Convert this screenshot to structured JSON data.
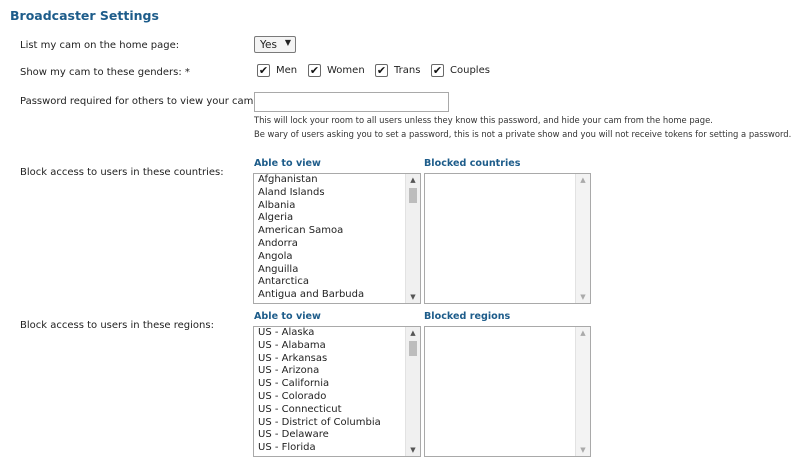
{
  "title": "Broadcaster Settings",
  "home_page": {
    "label": "List my cam on the home page:",
    "value": "Yes",
    "arrow_icon": "triangle-down"
  },
  "genders": {
    "label": "Show my cam to these genders: *",
    "options": [
      {
        "label": "Men",
        "checked": true
      },
      {
        "label": "Women",
        "checked": true
      },
      {
        "label": "Trans",
        "checked": true
      },
      {
        "label": "Couples",
        "checked": true
      }
    ]
  },
  "password": {
    "label": "Password required for others to view your cam:",
    "value": "",
    "note1": "This will lock your room to all users unless they know this password, and hide your cam from the home page.",
    "note2": "Be wary of users asking you to set a password, this is not a private show and you will not receive tokens for setting a password."
  },
  "countries": {
    "label": "Block access to users in these countries:",
    "able_header": "Able to view",
    "blocked_header": "Blocked countries",
    "able_items": [
      "Afghanistan",
      "Aland Islands",
      "Albania",
      "Algeria",
      "American Samoa",
      "Andorra",
      "Angola",
      "Anguilla",
      "Antarctica",
      "Antigua and Barbuda"
    ],
    "blocked_items": []
  },
  "regions": {
    "label": "Block access to users in these regions:",
    "able_header": "Able to view",
    "blocked_header": "Blocked regions",
    "able_items": [
      "US - Alaska",
      "US - Alabama",
      "US - Arkansas",
      "US - Arizona",
      "US - California",
      "US - Colorado",
      "US - Connecticut",
      "US - District of Columbia",
      "US - Delaware",
      "US - Florida"
    ],
    "blocked_items": []
  }
}
